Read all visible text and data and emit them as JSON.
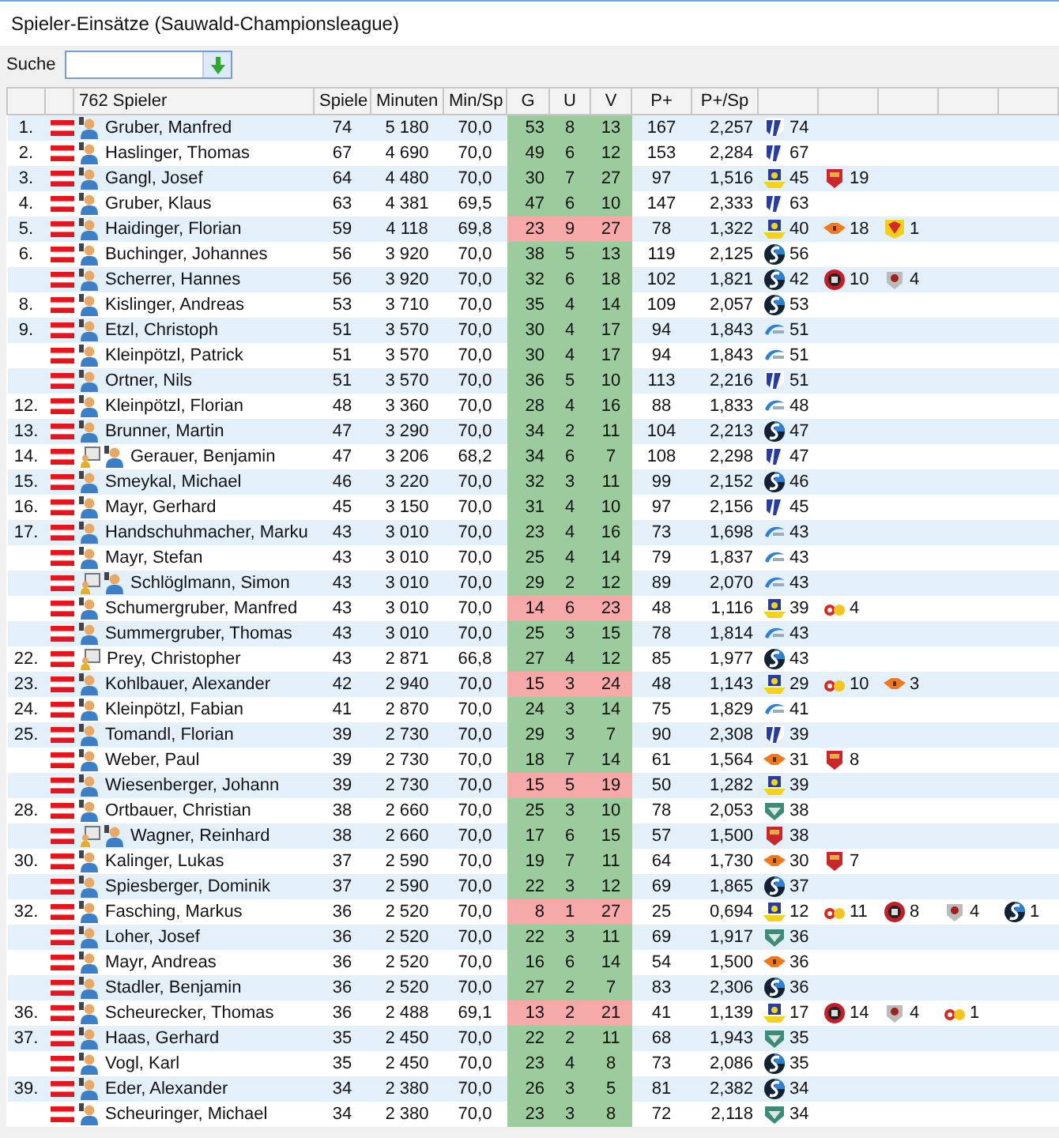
{
  "window": {
    "title": "Spieler-Einsätze (Sauwald-Championsleague)"
  },
  "search": {
    "label": "Suche"
  },
  "table": {
    "columns": [
      "762 Spieler",
      "Spiele",
      "Minuten",
      "Min/Sp",
      "G",
      "U",
      "V",
      "P+",
      "P+/Sp"
    ],
    "rows": [
      {
        "rank": "1.",
        "icons": [
          {
            "kind": "player"
          }
        ],
        "name": "Gruber, Manfred",
        "games": "74",
        "minutes": "5 180",
        "min_per_game": "70,0",
        "g": "53",
        "u": "8",
        "v": "13",
        "bad": false,
        "points": "167",
        "points_per_game": "2,257",
        "clubs": [
          {
            "kind": "stripes",
            "count": "74"
          }
        ]
      },
      {
        "rank": "2.",
        "icons": [
          {
            "kind": "player"
          }
        ],
        "name": "Haslinger, Thomas",
        "games": "67",
        "minutes": "4 690",
        "min_per_game": "70,0",
        "g": "49",
        "u": "6",
        "v": "12",
        "bad": false,
        "points": "153",
        "points_per_game": "2,284",
        "clubs": [
          {
            "kind": "stripes",
            "count": "67"
          }
        ]
      },
      {
        "rank": "3.",
        "icons": [
          {
            "kind": "player"
          }
        ],
        "name": "Gangl, Josef",
        "games": "64",
        "minutes": "4 480",
        "min_per_game": "70,0",
        "g": "30",
        "u": "7",
        "v": "27",
        "bad": false,
        "points": "97",
        "points_per_game": "1,516",
        "clubs": [
          {
            "kind": "gold",
            "count": "45"
          },
          {
            "kind": "redshield",
            "count": "19"
          }
        ]
      },
      {
        "rank": "4.",
        "icons": [
          {
            "kind": "player"
          }
        ],
        "name": "Gruber, Klaus",
        "games": "63",
        "minutes": "4 381",
        "min_per_game": "69,5",
        "g": "47",
        "u": "6",
        "v": "10",
        "bad": false,
        "points": "147",
        "points_per_game": "2,333",
        "clubs": [
          {
            "kind": "stripes",
            "count": "63"
          }
        ]
      },
      {
        "rank": "5.",
        "icons": [
          {
            "kind": "player"
          }
        ],
        "name": "Haidinger, Florian",
        "games": "59",
        "minutes": "4 118",
        "min_per_game": "69,8",
        "g": "23",
        "u": "9",
        "v": "27",
        "bad": true,
        "points": "78",
        "points_per_game": "1,322",
        "clubs": [
          {
            "kind": "gold",
            "count": "40"
          },
          {
            "kind": "orange",
            "count": "18"
          },
          {
            "kind": "yellowred",
            "count": "1"
          }
        ]
      },
      {
        "rank": "6.",
        "icons": [
          {
            "kind": "player"
          }
        ],
        "name": "Buchinger, Johannes",
        "games": "56",
        "minutes": "3 920",
        "min_per_game": "70,0",
        "g": "38",
        "u": "5",
        "v": "13",
        "bad": false,
        "points": "119",
        "points_per_game": "2,125",
        "clubs": [
          {
            "kind": "ball",
            "count": "56"
          }
        ]
      },
      {
        "icons": [
          {
            "kind": "player"
          }
        ],
        "name": "Scherrer, Hannes",
        "games": "56",
        "minutes": "3 920",
        "min_per_game": "70,0",
        "g": "32",
        "u": "6",
        "v": "18",
        "bad": false,
        "points": "102",
        "points_per_game": "1,821",
        "clubs": [
          {
            "kind": "ball",
            "count": "42"
          },
          {
            "kind": "redcircle",
            "count": "10"
          },
          {
            "kind": "grey",
            "count": "4"
          }
        ]
      },
      {
        "rank": "8.",
        "icons": [
          {
            "kind": "player"
          }
        ],
        "name": "Kislinger, Andreas",
        "games": "53",
        "minutes": "3 710",
        "min_per_game": "70,0",
        "g": "35",
        "u": "4",
        "v": "14",
        "bad": false,
        "points": "109",
        "points_per_game": "2,057",
        "clubs": [
          {
            "kind": "ball",
            "count": "53"
          }
        ]
      },
      {
        "rank": "9.",
        "icons": [
          {
            "kind": "player"
          }
        ],
        "name": "Etzl, Christoph",
        "games": "51",
        "minutes": "3 570",
        "min_per_game": "70,0",
        "g": "30",
        "u": "4",
        "v": "17",
        "bad": false,
        "points": "94",
        "points_per_game": "1,843",
        "clubs": [
          {
            "kind": "wave",
            "count": "51"
          }
        ]
      },
      {
        "icons": [
          {
            "kind": "player"
          }
        ],
        "name": "Kleinpötzl, Patrick",
        "games": "51",
        "minutes": "3 570",
        "min_per_game": "70,0",
        "g": "30",
        "u": "4",
        "v": "17",
        "bad": false,
        "points": "94",
        "points_per_game": "1,843",
        "clubs": [
          {
            "kind": "wave",
            "count": "51"
          }
        ]
      },
      {
        "icons": [
          {
            "kind": "player"
          }
        ],
        "name": "Ortner, Nils",
        "games": "51",
        "minutes": "3 570",
        "min_per_game": "70,0",
        "g": "36",
        "u": "5",
        "v": "10",
        "bad": false,
        "points": "113",
        "points_per_game": "2,216",
        "clubs": [
          {
            "kind": "stripes",
            "count": "51"
          }
        ]
      },
      {
        "rank": "12.",
        "icons": [
          {
            "kind": "player"
          }
        ],
        "name": "Kleinpötzl, Florian",
        "games": "48",
        "minutes": "3 360",
        "min_per_game": "70,0",
        "g": "28",
        "u": "4",
        "v": "16",
        "bad": false,
        "points": "88",
        "points_per_game": "1,833",
        "clubs": [
          {
            "kind": "wave",
            "count": "48"
          }
        ]
      },
      {
        "rank": "13.",
        "icons": [
          {
            "kind": "player"
          }
        ],
        "name": "Brunner, Martin",
        "games": "47",
        "minutes": "3 290",
        "min_per_game": "70,0",
        "g": "34",
        "u": "2",
        "v": "11",
        "bad": false,
        "points": "104",
        "points_per_game": "2,213",
        "clubs": [
          {
            "kind": "ball",
            "count": "47"
          }
        ]
      },
      {
        "rank": "14.",
        "icons": [
          {
            "kind": "board"
          },
          {
            "kind": "player"
          }
        ],
        "name": "Gerauer, Benjamin",
        "games": "47",
        "minutes": "3 206",
        "min_per_game": "68,2",
        "g": "34",
        "u": "6",
        "v": "7",
        "bad": false,
        "points": "108",
        "points_per_game": "2,298",
        "clubs": [
          {
            "kind": "stripes",
            "count": "47"
          }
        ]
      },
      {
        "rank": "15.",
        "icons": [
          {
            "kind": "player"
          }
        ],
        "name": "Smeykal, Michael",
        "games": "46",
        "minutes": "3 220",
        "min_per_game": "70,0",
        "g": "32",
        "u": "3",
        "v": "11",
        "bad": false,
        "points": "99",
        "points_per_game": "2,152",
        "clubs": [
          {
            "kind": "ball",
            "count": "46"
          }
        ]
      },
      {
        "rank": "16.",
        "icons": [
          {
            "kind": "player"
          }
        ],
        "name": "Mayr, Gerhard",
        "games": "45",
        "minutes": "3 150",
        "min_per_game": "70,0",
        "g": "31",
        "u": "4",
        "v": "10",
        "bad": false,
        "points": "97",
        "points_per_game": "2,156",
        "clubs": [
          {
            "kind": "stripes",
            "count": "45"
          }
        ]
      },
      {
        "rank": "17.",
        "icons": [
          {
            "kind": "player"
          }
        ],
        "name": "Handschuhmacher, Marku",
        "games": "43",
        "minutes": "3 010",
        "min_per_game": "70,0",
        "g": "23",
        "u": "4",
        "v": "16",
        "bad": false,
        "points": "73",
        "points_per_game": "1,698",
        "clubs": [
          {
            "kind": "wave",
            "count": "43"
          }
        ]
      },
      {
        "icons": [
          {
            "kind": "player"
          }
        ],
        "name": "Mayr, Stefan",
        "games": "43",
        "minutes": "3 010",
        "min_per_game": "70,0",
        "g": "25",
        "u": "4",
        "v": "14",
        "bad": false,
        "points": "79",
        "points_per_game": "1,837",
        "clubs": [
          {
            "kind": "wave",
            "count": "43"
          }
        ]
      },
      {
        "icons": [
          {
            "kind": "board"
          },
          {
            "kind": "player"
          }
        ],
        "name": "Schlöglmann, Simon",
        "games": "43",
        "minutes": "3 010",
        "min_per_game": "70,0",
        "g": "29",
        "u": "2",
        "v": "12",
        "bad": false,
        "points": "89",
        "points_per_game": "2,070",
        "clubs": [
          {
            "kind": "wave",
            "count": "43"
          }
        ]
      },
      {
        "icons": [
          {
            "kind": "player"
          }
        ],
        "name": "Schumergruber, Manfred",
        "games": "43",
        "minutes": "3 010",
        "min_per_game": "70,0",
        "g": "14",
        "u": "6",
        "v": "23",
        "bad": true,
        "points": "48",
        "points_per_game": "1,116",
        "clubs": [
          {
            "kind": "gold",
            "count": "39"
          },
          {
            "kind": "bike",
            "count": "4"
          }
        ]
      },
      {
        "icons": [
          {
            "kind": "player"
          }
        ],
        "name": "Summergruber, Thomas",
        "games": "43",
        "minutes": "3 010",
        "min_per_game": "70,0",
        "g": "25",
        "u": "3",
        "v": "15",
        "bad": false,
        "points": "78",
        "points_per_game": "1,814",
        "clubs": [
          {
            "kind": "wave",
            "count": "43"
          }
        ]
      },
      {
        "rank": "22.",
        "icons": [
          {
            "kind": "board"
          }
        ],
        "name": "Prey, Christopher",
        "games": "43",
        "minutes": "2 871",
        "min_per_game": "66,8",
        "g": "27",
        "u": "4",
        "v": "12",
        "bad": false,
        "points": "85",
        "points_per_game": "1,977",
        "clubs": [
          {
            "kind": "ball",
            "count": "43"
          }
        ]
      },
      {
        "rank": "23.",
        "icons": [
          {
            "kind": "player"
          }
        ],
        "name": "Kohlbauer, Alexander",
        "games": "42",
        "minutes": "2 940",
        "min_per_game": "70,0",
        "g": "15",
        "u": "3",
        "v": "24",
        "bad": true,
        "points": "48",
        "points_per_game": "1,143",
        "clubs": [
          {
            "kind": "gold",
            "count": "29"
          },
          {
            "kind": "bike",
            "count": "10"
          },
          {
            "kind": "orange",
            "count": "3"
          }
        ]
      },
      {
        "rank": "24.",
        "icons": [
          {
            "kind": "player"
          }
        ],
        "name": "Kleinpötzl, Fabian",
        "games": "41",
        "minutes": "2 870",
        "min_per_game": "70,0",
        "g": "24",
        "u": "3",
        "v": "14",
        "bad": false,
        "points": "75",
        "points_per_game": "1,829",
        "clubs": [
          {
            "kind": "wave",
            "count": "41"
          }
        ]
      },
      {
        "rank": "25.",
        "icons": [
          {
            "kind": "player"
          }
        ],
        "name": "Tomandl, Florian",
        "games": "39",
        "minutes": "2 730",
        "min_per_game": "70,0",
        "g": "29",
        "u": "3",
        "v": "7",
        "bad": false,
        "points": "90",
        "points_per_game": "2,308",
        "clubs": [
          {
            "kind": "stripes",
            "count": "39"
          }
        ]
      },
      {
        "icons": [
          {
            "kind": "player"
          }
        ],
        "name": "Weber, Paul",
        "games": "39",
        "minutes": "2 730",
        "min_per_game": "70,0",
        "g": "18",
        "u": "7",
        "v": "14",
        "bad": false,
        "points": "61",
        "points_per_game": "1,564",
        "clubs": [
          {
            "kind": "orange",
            "count": "31"
          },
          {
            "kind": "redshield",
            "count": "8"
          }
        ]
      },
      {
        "icons": [
          {
            "kind": "player"
          }
        ],
        "name": "Wiesenberger, Johann",
        "games": "39",
        "minutes": "2 730",
        "min_per_game": "70,0",
        "g": "15",
        "u": "5",
        "v": "19",
        "bad": true,
        "points": "50",
        "points_per_game": "1,282",
        "clubs": [
          {
            "kind": "gold",
            "count": "39"
          }
        ]
      },
      {
        "rank": "28.",
        "icons": [
          {
            "kind": "player"
          }
        ],
        "name": "Ortbauer, Christian",
        "games": "38",
        "minutes": "2 660",
        "min_per_game": "70,0",
        "g": "25",
        "u": "3",
        "v": "10",
        "bad": false,
        "points": "78",
        "points_per_game": "2,053",
        "clubs": [
          {
            "kind": "green",
            "count": "38"
          }
        ]
      },
      {
        "icons": [
          {
            "kind": "board"
          },
          {
            "kind": "player"
          }
        ],
        "name": "Wagner, Reinhard",
        "games": "38",
        "minutes": "2 660",
        "min_per_game": "70,0",
        "g": "17",
        "u": "6",
        "v": "15",
        "bad": false,
        "points": "57",
        "points_per_game": "1,500",
        "clubs": [
          {
            "kind": "redshield",
            "count": "38"
          }
        ]
      },
      {
        "rank": "30.",
        "icons": [
          {
            "kind": "player"
          }
        ],
        "name": "Kalinger, Lukas",
        "games": "37",
        "minutes": "2 590",
        "min_per_game": "70,0",
        "g": "19",
        "u": "7",
        "v": "11",
        "bad": false,
        "points": "64",
        "points_per_game": "1,730",
        "clubs": [
          {
            "kind": "orange",
            "count": "30"
          },
          {
            "kind": "redshield",
            "count": "7"
          }
        ]
      },
      {
        "icons": [
          {
            "kind": "player"
          }
        ],
        "name": "Spiesberger, Dominik",
        "games": "37",
        "minutes": "2 590",
        "min_per_game": "70,0",
        "g": "22",
        "u": "3",
        "v": "12",
        "bad": false,
        "points": "69",
        "points_per_game": "1,865",
        "clubs": [
          {
            "kind": "ball",
            "count": "37"
          }
        ]
      },
      {
        "rank": "32.",
        "icons": [
          {
            "kind": "player"
          }
        ],
        "name": "Fasching, Markus",
        "games": "36",
        "minutes": "2 520",
        "min_per_game": "70,0",
        "g": "8",
        "u": "1",
        "v": "27",
        "bad": true,
        "points": "25",
        "points_per_game": "0,694",
        "clubs": [
          {
            "kind": "gold",
            "count": "12"
          },
          {
            "kind": "bike",
            "count": "11"
          },
          {
            "kind": "redcircle",
            "count": "8"
          },
          {
            "kind": "grey",
            "count": "4"
          },
          {
            "kind": "ball",
            "count": "1"
          }
        ]
      },
      {
        "icons": [
          {
            "kind": "player"
          }
        ],
        "name": "Loher, Josef",
        "games": "36",
        "minutes": "2 520",
        "min_per_game": "70,0",
        "g": "22",
        "u": "3",
        "v": "11",
        "bad": false,
        "points": "69",
        "points_per_game": "1,917",
        "clubs": [
          {
            "kind": "green",
            "count": "36"
          }
        ]
      },
      {
        "icons": [
          {
            "kind": "player"
          }
        ],
        "name": "Mayr, Andreas",
        "games": "36",
        "minutes": "2 520",
        "min_per_game": "70,0",
        "g": "16",
        "u": "6",
        "v": "14",
        "bad": false,
        "points": "54",
        "points_per_game": "1,500",
        "clubs": [
          {
            "kind": "orange",
            "count": "36"
          }
        ]
      },
      {
        "icons": [
          {
            "kind": "player"
          }
        ],
        "name": "Stadler, Benjamin",
        "games": "36",
        "minutes": "2 520",
        "min_per_game": "70,0",
        "g": "27",
        "u": "2",
        "v": "7",
        "bad": false,
        "points": "83",
        "points_per_game": "2,306",
        "clubs": [
          {
            "kind": "ball",
            "count": "36"
          }
        ]
      },
      {
        "rank": "36.",
        "icons": [
          {
            "kind": "player"
          }
        ],
        "name": "Scheurecker, Thomas",
        "games": "36",
        "minutes": "2 488",
        "min_per_game": "69,1",
        "g": "13",
        "u": "2",
        "v": "21",
        "bad": true,
        "points": "41",
        "points_per_game": "1,139",
        "clubs": [
          {
            "kind": "gold",
            "count": "17"
          },
          {
            "kind": "redcircle",
            "count": "14"
          },
          {
            "kind": "grey",
            "count": "4"
          },
          {
            "kind": "bike",
            "count": "1"
          }
        ]
      },
      {
        "rank": "37.",
        "icons": [
          {
            "kind": "player"
          }
        ],
        "name": "Haas, Gerhard",
        "games": "35",
        "minutes": "2 450",
        "min_per_game": "70,0",
        "g": "22",
        "u": "2",
        "v": "11",
        "bad": false,
        "points": "68",
        "points_per_game": "1,943",
        "clubs": [
          {
            "kind": "green",
            "count": "35"
          }
        ]
      },
      {
        "icons": [
          {
            "kind": "player"
          }
        ],
        "name": "Vogl, Karl",
        "games": "35",
        "minutes": "2 450",
        "min_per_game": "70,0",
        "g": "23",
        "u": "4",
        "v": "8",
        "bad": false,
        "points": "73",
        "points_per_game": "2,086",
        "clubs": [
          {
            "kind": "ball",
            "count": "35"
          }
        ]
      },
      {
        "rank": "39.",
        "icons": [
          {
            "kind": "player"
          }
        ],
        "name": "Eder, Alexander",
        "games": "34",
        "minutes": "2 380",
        "min_per_game": "70,0",
        "g": "26",
        "u": "3",
        "v": "5",
        "bad": false,
        "points": "81",
        "points_per_game": "2,382",
        "clubs": [
          {
            "kind": "ball",
            "count": "34"
          }
        ]
      },
      {
        "icons": [
          {
            "kind": "player"
          }
        ],
        "name": "Scheuringer, Michael",
        "games": "34",
        "minutes": "2 380",
        "min_per_game": "70,0",
        "g": "23",
        "u": "3",
        "v": "8",
        "bad": false,
        "points": "72",
        "points_per_game": "2,118",
        "clubs": [
          {
            "kind": "green",
            "count": "34"
          }
        ]
      }
    ]
  }
}
